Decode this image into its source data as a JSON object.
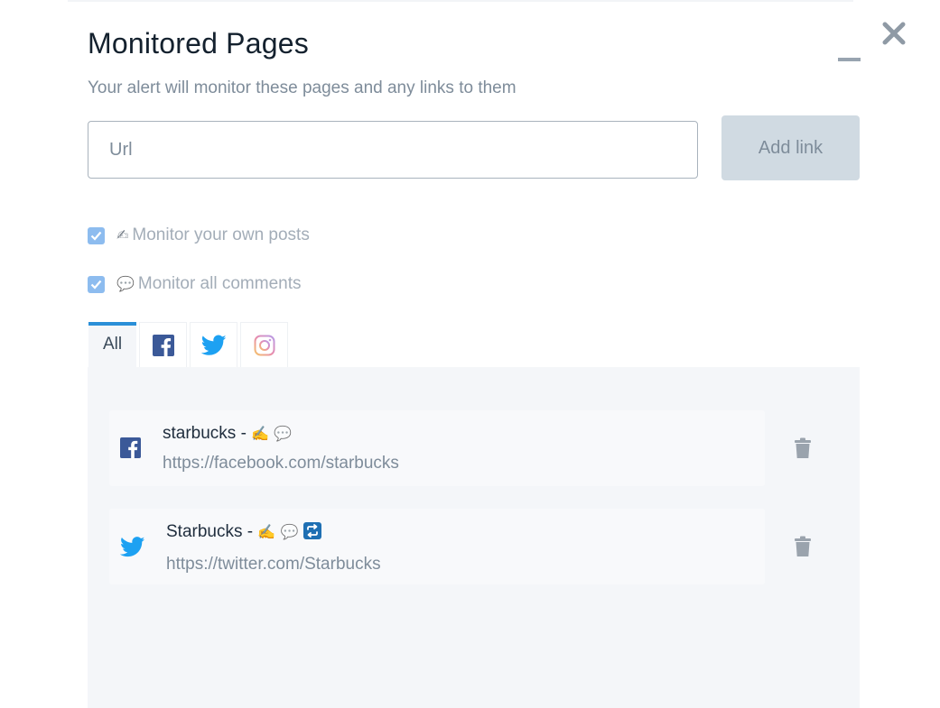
{
  "header": {
    "title": "Monitored Pages",
    "subtitle": "Your alert will monitor these pages and any links to them"
  },
  "url_input": {
    "placeholder": "Url",
    "value": ""
  },
  "add_button": {
    "label": "Add link"
  },
  "options": [
    {
      "emoji": "✍",
      "label": "Monitor your own posts",
      "checked": true
    },
    {
      "emoji": "💬",
      "label": "Monitor all comments",
      "checked": true
    }
  ],
  "tabs": [
    {
      "label": "All",
      "active": true
    },
    {
      "icon": "facebook-icon",
      "active": false
    },
    {
      "icon": "twitter-icon",
      "active": false
    },
    {
      "icon": "instagram-icon",
      "active": false
    }
  ],
  "pages": [
    {
      "network_icon": "facebook-icon",
      "name": "starbucks - ",
      "flags": [
        "writing-hand",
        "speech-bubble"
      ],
      "url": "https://facebook.com/starbucks"
    },
    {
      "network_icon": "twitter-icon",
      "name": "Starbucks - ",
      "flags": [
        "writing-hand",
        "speech-bubble",
        "retweet"
      ],
      "url": "https://twitter.com/Starbucks"
    }
  ],
  "colors": {
    "accent": "#2a8fd8",
    "facebook": "#3b5998",
    "twitter": "#1da1f2",
    "checkbox": "#8dbcef",
    "panel_bg": "#f4f6f9",
    "button_bg": "#d0dae2"
  }
}
